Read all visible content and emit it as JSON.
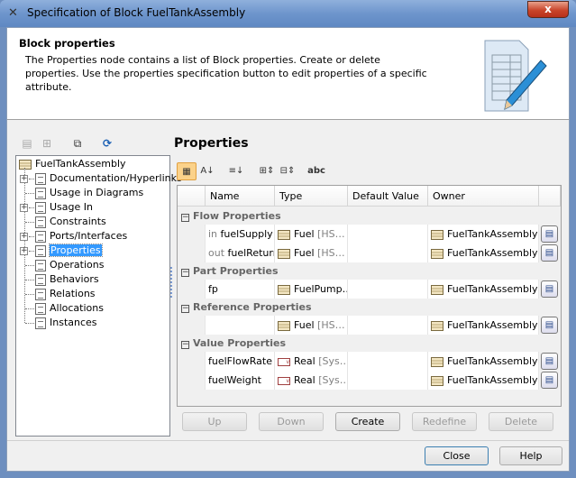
{
  "window": {
    "title": "Specification of Block FuelTankAssembly",
    "close_label": "x"
  },
  "header": {
    "title": "Block properties",
    "description": "The Properties node contains a list of Block properties. Create or delete properties. Use the properties specification button to edit properties of a specific attribute."
  },
  "tree": {
    "root": "FuelTankAssembly",
    "items": [
      {
        "label": "Documentation/Hyperlinks",
        "expandable": true
      },
      {
        "label": "Usage in Diagrams",
        "expandable": false
      },
      {
        "label": "Usage In",
        "expandable": true
      },
      {
        "label": "Constraints",
        "expandable": false
      },
      {
        "label": "Ports/Interfaces",
        "expandable": true
      },
      {
        "label": "Properties",
        "expandable": true,
        "selected": true
      },
      {
        "label": "Operations",
        "expandable": false
      },
      {
        "label": "Behaviors",
        "expandable": false
      },
      {
        "label": "Relations",
        "expandable": false
      },
      {
        "label": "Allocations",
        "expandable": false
      },
      {
        "label": "Instances",
        "expandable": false
      }
    ]
  },
  "panel": {
    "title": "Properties",
    "toolbar_abc": "abc"
  },
  "table": {
    "columns": [
      "Name",
      "Type",
      "Default Value",
      "Owner"
    ],
    "groups": [
      {
        "label": "Flow Properties",
        "rows": [
          {
            "prefix": "in",
            "name": "fuelSupply",
            "type": "Fuel",
            "type_extra": "[HS…",
            "type_icon": "block",
            "default": "",
            "owner": "FuelTankAssembly…"
          },
          {
            "prefix": "out",
            "name": "fuelReturn",
            "type": "Fuel",
            "type_extra": "[HS…",
            "type_icon": "block",
            "default": "",
            "owner": "FuelTankAssembly…"
          }
        ]
      },
      {
        "label": "Part Properties",
        "rows": [
          {
            "prefix": "",
            "name": "fp",
            "type": "FuelPump…",
            "type_extra": "",
            "type_icon": "block",
            "default": "",
            "owner": "FuelTankAssembly…"
          }
        ]
      },
      {
        "label": "Reference Properties",
        "rows": [
          {
            "prefix": "",
            "name": "",
            "type": "Fuel",
            "type_extra": "[HS…",
            "type_icon": "block",
            "default": "",
            "owner": "FuelTankAssembly…"
          }
        ]
      },
      {
        "label": "Value Properties",
        "rows": [
          {
            "prefix": "",
            "name": "fuelFlowRate",
            "type": "Real",
            "type_extra": "[Sys…",
            "type_icon": "value",
            "default": "",
            "owner": "FuelTankAssembly…"
          },
          {
            "prefix": "",
            "name": "fuelWeight",
            "type": "Real",
            "type_extra": "[Sys…",
            "type_icon": "value",
            "default": "",
            "owner": "FuelTankAssembly…"
          }
        ]
      }
    ]
  },
  "buttons": {
    "up": "Up",
    "down": "Down",
    "create": "Create",
    "redefine": "Redefine",
    "delete": "Delete",
    "close": "Close",
    "help": "Help"
  }
}
